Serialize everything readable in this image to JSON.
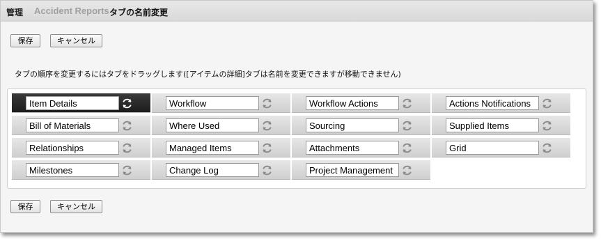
{
  "breadcrumb": {
    "admin": "管理",
    "reports": "Accident Reports",
    "current": "タブの名前変更"
  },
  "buttons": {
    "save": "保存",
    "cancel": "キャンセル"
  },
  "instruction": "タブの順序を変更するにはタブをドラッグします([アイテムの詳細]タブは名前を変更できますが移動できません)",
  "tabs": [
    {
      "value": "Item Details",
      "icon": "refresh-icon"
    },
    {
      "value": "Workflow",
      "icon": "refresh-icon"
    },
    {
      "value": "Workflow Actions",
      "icon": "refresh-icon"
    },
    {
      "value": "Actions Notifications",
      "icon": "refresh-icon"
    },
    {
      "value": "Bill of Materials",
      "icon": "refresh-icon"
    },
    {
      "value": "Where Used",
      "icon": "refresh-icon"
    },
    {
      "value": "Sourcing",
      "icon": "refresh-icon"
    },
    {
      "value": "Supplied Items",
      "icon": "refresh-icon"
    },
    {
      "value": "Relationships",
      "icon": "refresh-icon"
    },
    {
      "value": "Managed Items",
      "icon": "refresh-icon"
    },
    {
      "value": "Attachments",
      "icon": "refresh-icon"
    },
    {
      "value": "Grid",
      "icon": "refresh-icon"
    },
    {
      "value": "Milestones",
      "icon": "refresh-icon"
    },
    {
      "value": "Change Log",
      "icon": "refresh-icon"
    },
    {
      "value": "Project Management",
      "icon": "refresh-icon"
    }
  ],
  "selected_tab": "Item Details",
  "colors": {
    "selected_tab_bg": "#2a2a2a",
    "tab_bg": "#dcdcdc",
    "breadcrumb_link": "#a0a0a0"
  }
}
